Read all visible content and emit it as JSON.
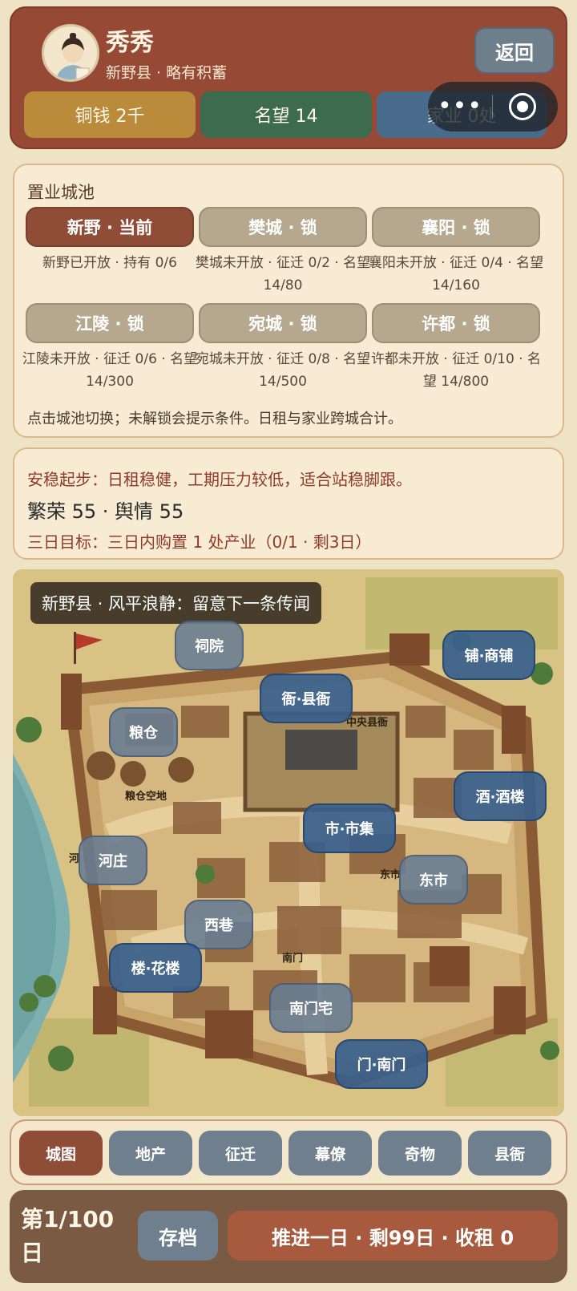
{
  "header": {
    "name": "秀秀",
    "subtitle": "新野县 · 略有积蓄",
    "back_label": "返回",
    "stats": {
      "money": "铜钱 2千",
      "fame": "名望 14",
      "estate": "家业 0处"
    }
  },
  "cities": {
    "title": "置业城池",
    "items": [
      {
        "label": "新野 · 当前",
        "info": "新野已开放 · 持有 0/6"
      },
      {
        "label": "樊城 · 锁",
        "info": "樊城未开放 · 征迁 0/2 · 名望 14/80"
      },
      {
        "label": "襄阳 · 锁",
        "info": "襄阳未开放 · 征迁 0/4 · 名望 14/160"
      },
      {
        "label": "江陵 · 锁",
        "info": "江陵未开放 · 征迁 0/6 · 名望 14/300"
      },
      {
        "label": "宛城 · 锁",
        "info": "宛城未开放 · 征迁 0/8 · 名望 14/500"
      },
      {
        "label": "许都 · 锁",
        "info": "许都未开放 · 征迁 0/10 · 名望 14/800"
      }
    ],
    "hint": "点击城池切换；未解锁会提示条件。日租与家业跨城合计。"
  },
  "goal": {
    "strategy": "安稳起步：日租稳健，工期压力较低，适合站稳脚跟。",
    "prosperity": "繁荣 55 · 舆情 55",
    "target": "三日目标：三日内购置 1 处产业（0/1 · 剩3日）"
  },
  "map": {
    "banner": "新野县 · 风平浪静：留意下一条传闻",
    "locations": {
      "shrine": "祠院",
      "shop": "铺·商铺",
      "yamen": "衙·县衙",
      "granary": "粮仓",
      "tavern": "酒·酒楼",
      "market": "市·市集",
      "river_village": "河庄",
      "east_market": "东市",
      "west_alley": "西巷",
      "flower_house": "楼·花楼",
      "south_gate_house": "南门宅",
      "south_gate": "门·南门"
    },
    "labels": {
      "granary_field": "粮仓空地",
      "central_yamen": "中央县衙",
      "east_market_sign": "东市",
      "south_gate_sign": "南门",
      "river_sign": "河"
    }
  },
  "tabs": [
    "城图",
    "地产",
    "征迁",
    "幕僚",
    "奇物",
    "县衙"
  ],
  "footer": {
    "day": "第1/100日",
    "save_label": "存档",
    "advance_label": "推进一日 · 剩99日 · 收租 0"
  }
}
